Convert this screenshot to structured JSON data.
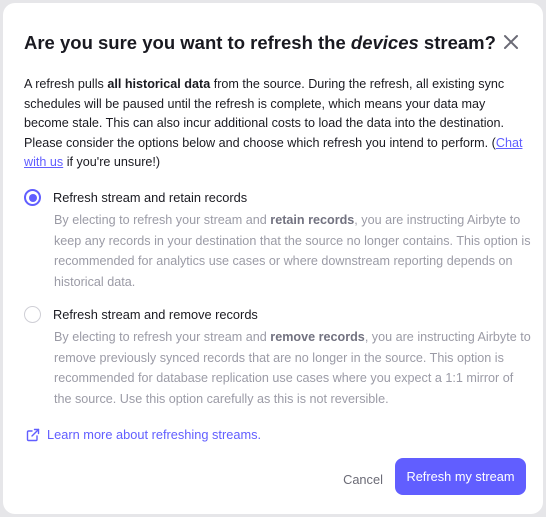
{
  "dialog": {
    "title_prefix": "Are you sure you want to refresh the ",
    "title_emphasis": "devices",
    "title_suffix": " stream?",
    "close_icon": "close-icon"
  },
  "intro": {
    "part1": "A refresh pulls ",
    "bold": "all historical data",
    "part2": " from the source. During the refresh, all existing sync schedules will be paused until the refresh is complete, which means your data may become stale. This can also incur additional costs to load the data into the destination. Please consider the options below and choose which refresh you intend to perform. (",
    "link": "Chat with us",
    "part3": " if you're unsure!)"
  },
  "options": [
    {
      "label": "Refresh stream and retain records",
      "selected": true,
      "desc_part1": "By electing to refresh your stream and ",
      "desc_bold": "retain records",
      "desc_part2": ", you are instructing Airbyte to keep any records in your destination that the source no longer contains. This option is recommended for analytics use cases or where downstream reporting depends on historical data."
    },
    {
      "label": "Refresh stream and remove records",
      "selected": false,
      "desc_part1": "By electing to refresh your stream and ",
      "desc_bold": "remove records",
      "desc_part2": ", you are instructing Airbyte to remove previously synced records that are no longer in the source. This option is recommended for database replication use cases where you expect a 1:1 mirror of the source. Use this option carefully as this is not reversible."
    }
  ],
  "learn_more": {
    "label": "Learn more about refreshing streams.",
    "icon": "external-link-icon"
  },
  "footer": {
    "cancel_label": "Cancel",
    "confirm_label": "Refresh my stream"
  },
  "colors": {
    "accent": "#615eff",
    "text": "#1a1a21",
    "muted": "#9b9ba6"
  }
}
